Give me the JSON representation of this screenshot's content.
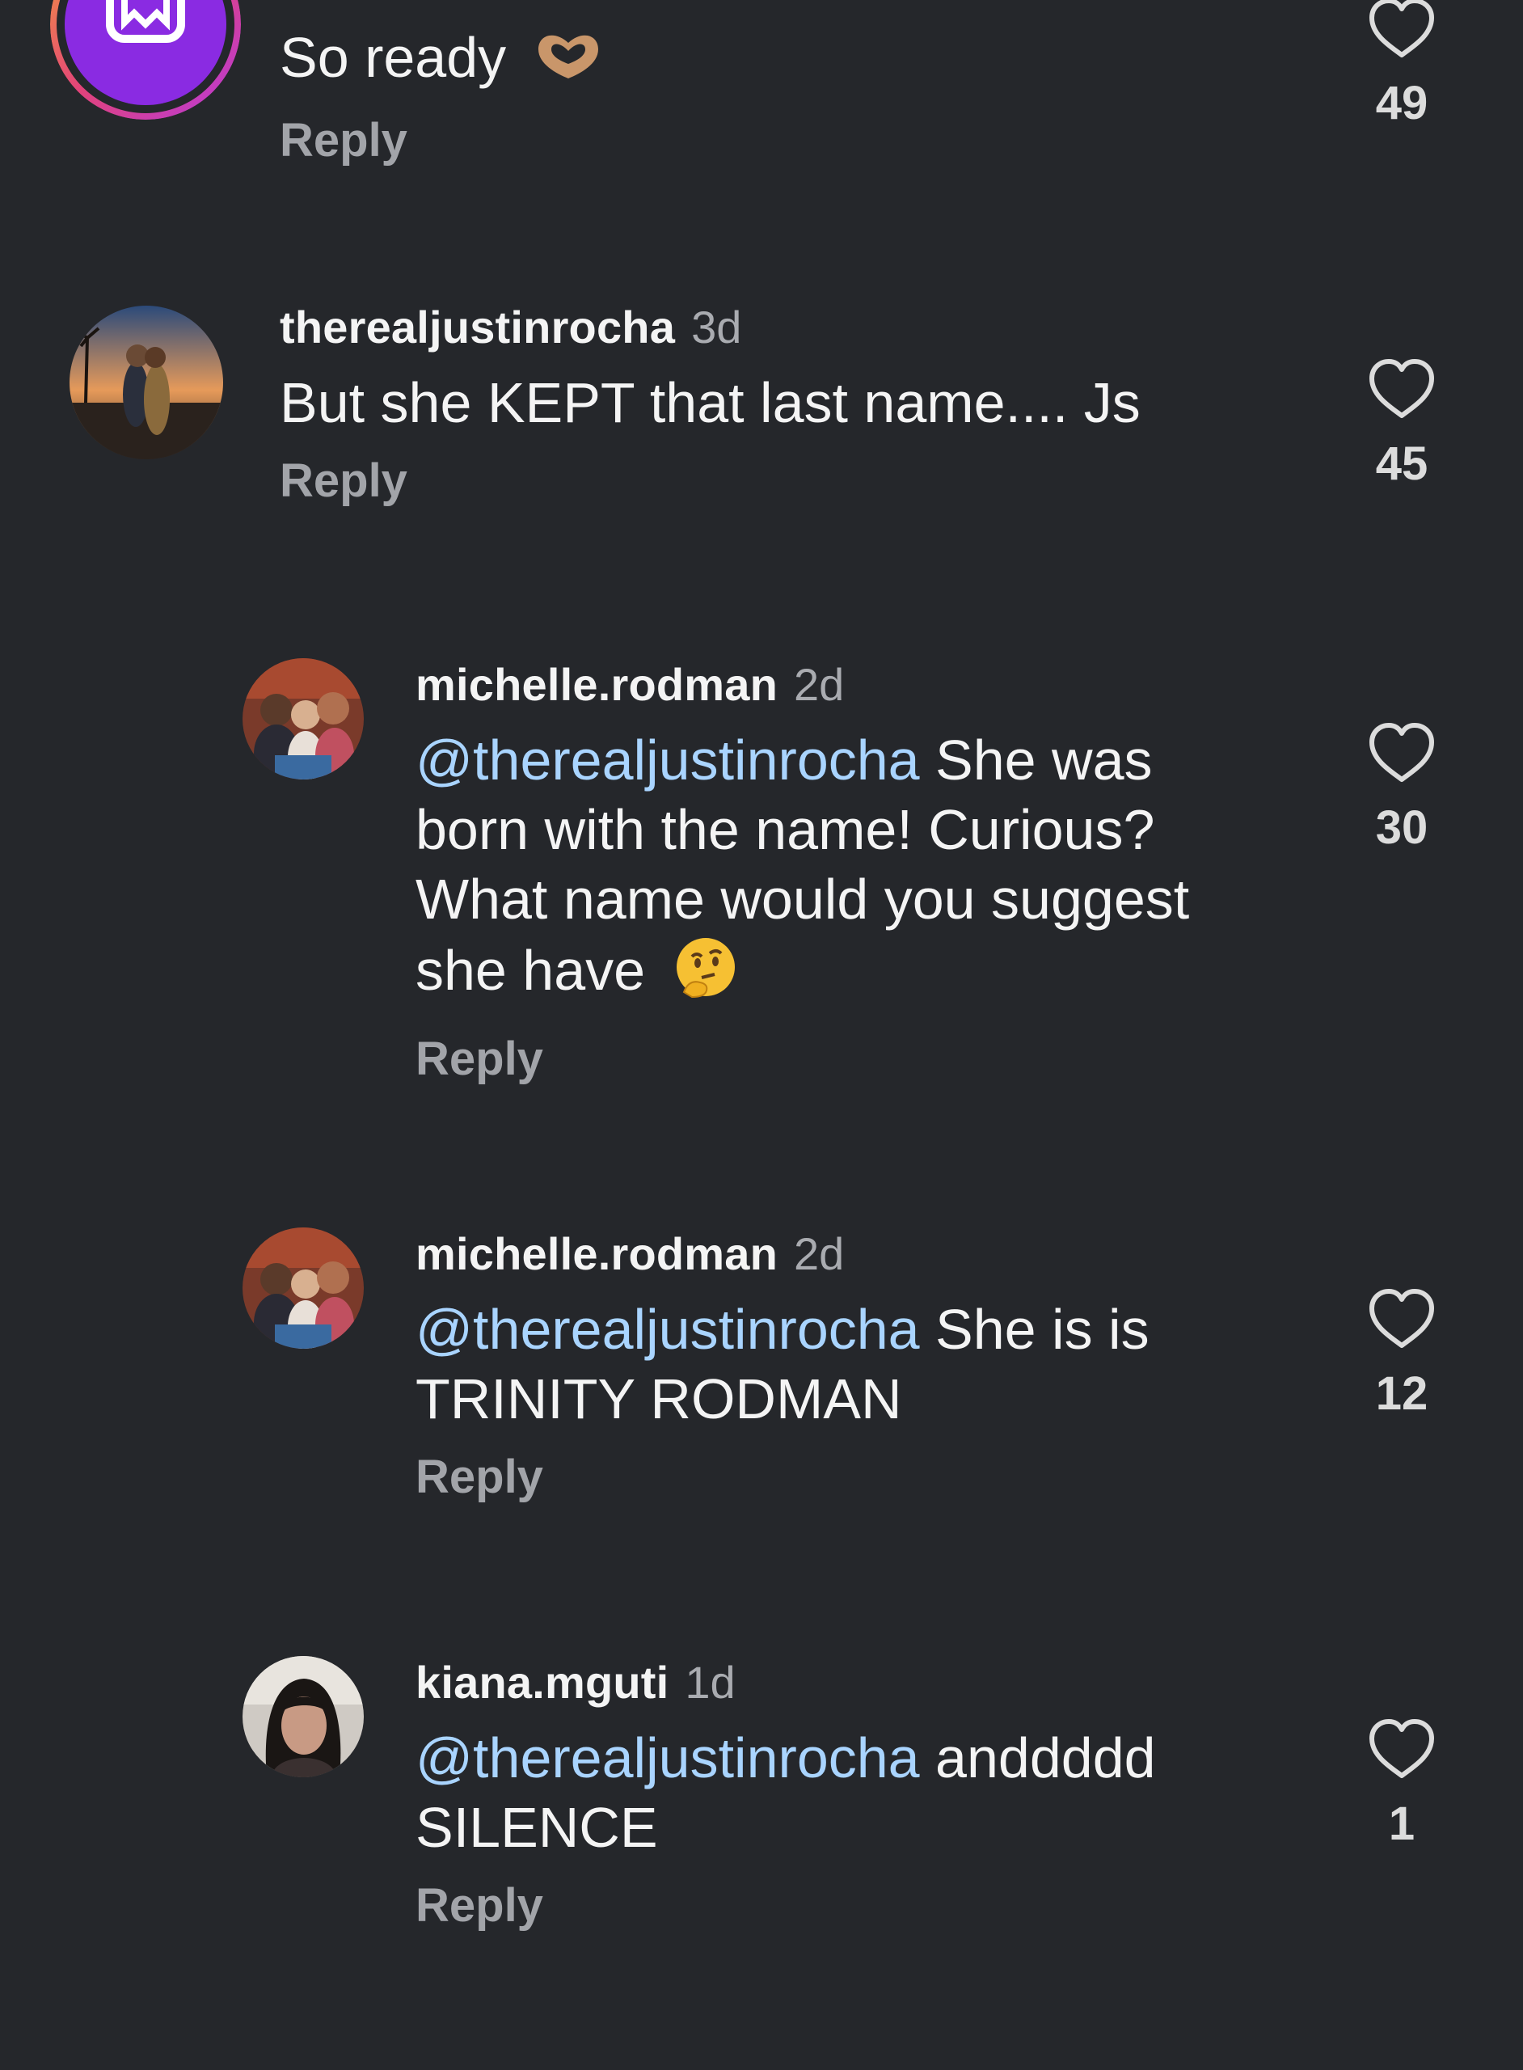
{
  "comments": [
    {
      "username": "",
      "time": "",
      "text": "So ready",
      "emoji": "heart-hands-emoji",
      "reply_label": "Reply",
      "likes": "49"
    },
    {
      "username": "therealjustinrocha",
      "time": "3d",
      "text": "But she KEPT that last name.... Js",
      "reply_label": "Reply",
      "likes": "45"
    },
    {
      "username": "michelle.rodman",
      "time": "2d",
      "mention": "@therealjustinrocha",
      "text_lines": [
        " She was",
        "born with the name! Curious?",
        "What name would you suggest",
        "she have"
      ],
      "emoji": "thinking-face-emoji",
      "reply_label": "Reply",
      "likes": "30"
    },
    {
      "username": "michelle.rodman",
      "time": "2d",
      "mention": "@therealjustinrocha",
      "text_lines": [
        " She is is",
        "TRINITY RODMAN"
      ],
      "reply_label": "Reply",
      "likes": "12"
    },
    {
      "username": "kiana.mguti",
      "time": "1d",
      "mention": "@therealjustinrocha",
      "text_lines": [
        " anddddd",
        "SILENCE"
      ],
      "reply_label": "Reply",
      "likes": "1"
    }
  ],
  "colors": {
    "background": "#25272b",
    "mention": "#a9d4ff",
    "muted": "#a9abb0",
    "avatar_ring": "#c63bd6"
  }
}
